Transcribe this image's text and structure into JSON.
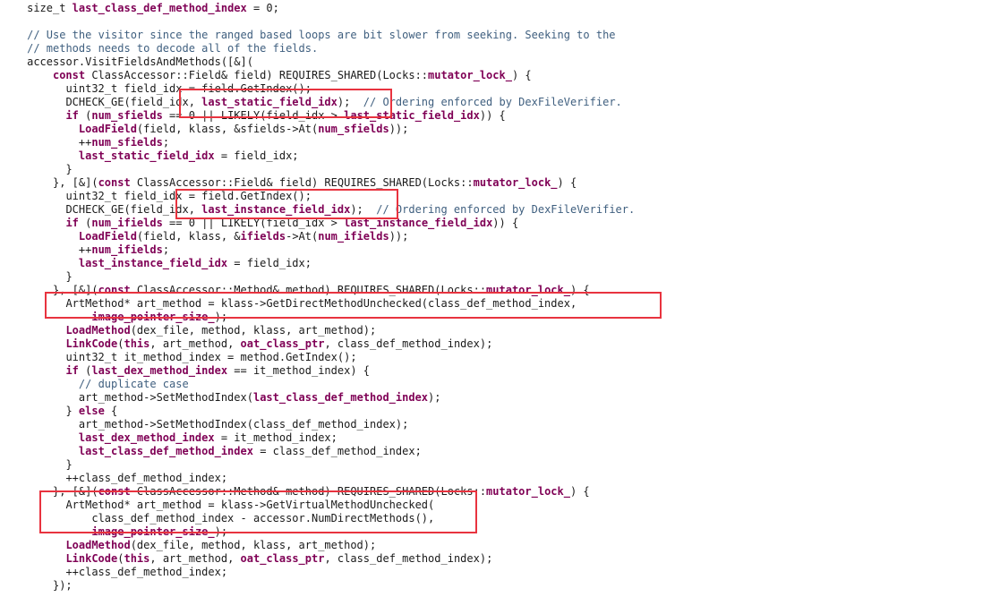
{
  "editor": {
    "language": "C++",
    "token_colors": {
      "keyword": "#7f0055",
      "identifier": "#7f0055",
      "comment": "#3f5f7f",
      "plain": "#1a1a1a",
      "highlight_box": "#e8333f"
    },
    "lines": [
      {
        "indent": "    ",
        "tokens": [
          [
            "plain",
            "size_t "
          ],
          [
            "var",
            "last_class_def_method_index"
          ],
          [
            "plain",
            " = 0;"
          ]
        ]
      },
      {
        "indent": "",
        "tokens": []
      },
      {
        "indent": "    ",
        "tokens": [
          [
            "cmt",
            "// Use the visitor since the ranged based loops are bit slower from seeking. Seeking to the"
          ]
        ]
      },
      {
        "indent": "    ",
        "tokens": [
          [
            "cmt",
            "// methods needs to decode all of the fields."
          ]
        ]
      },
      {
        "indent": "    ",
        "tokens": [
          [
            "plain",
            "accessor.VisitFieldsAndMethods([&]("
          ]
        ]
      },
      {
        "indent": "        ",
        "tokens": [
          [
            "kw",
            "const"
          ],
          [
            "plain",
            " ClassAccessor::Field& field) REQUIRES_SHARED(Locks::"
          ],
          [
            "var",
            "mutator_lock_"
          ],
          [
            "plain",
            ") {"
          ]
        ]
      },
      {
        "indent": "          ",
        "tokens": [
          [
            "plain",
            "uint32_t field_idx = field.GetIndex();"
          ]
        ]
      },
      {
        "indent": "          ",
        "tokens": [
          [
            "plain",
            "DCHECK_GE(field_idx, "
          ],
          [
            "var",
            "last_static_field_idx"
          ],
          [
            "plain",
            ");  "
          ],
          [
            "cmt",
            "// Ordering enforced by DexFileVerifier."
          ]
        ]
      },
      {
        "indent": "          ",
        "tokens": [
          [
            "kw",
            "if"
          ],
          [
            "plain",
            " ("
          ],
          [
            "var",
            "num_sfields"
          ],
          [
            "plain",
            " == 0 || LIKELY(field_idx > "
          ],
          [
            "var",
            "last_static_field_idx"
          ],
          [
            "plain",
            ")) {"
          ]
        ]
      },
      {
        "indent": "            ",
        "tokens": [
          [
            "func",
            "LoadField"
          ],
          [
            "plain",
            "(field, klass, &sfields->At("
          ],
          [
            "var",
            "num_sfields"
          ],
          [
            "plain",
            "));"
          ]
        ]
      },
      {
        "indent": "            ",
        "tokens": [
          [
            "plain",
            "++"
          ],
          [
            "var",
            "num_sfields"
          ],
          [
            "plain",
            ";"
          ]
        ]
      },
      {
        "indent": "            ",
        "tokens": [
          [
            "var",
            "last_static_field_idx"
          ],
          [
            "plain",
            " = field_idx;"
          ]
        ]
      },
      {
        "indent": "          ",
        "tokens": [
          [
            "plain",
            "}"
          ]
        ]
      },
      {
        "indent": "        ",
        "tokens": [
          [
            "plain",
            "}, [&]("
          ],
          [
            "kw",
            "const"
          ],
          [
            "plain",
            " ClassAccessor::Field& field) REQUIRES_SHARED(Locks::"
          ],
          [
            "var",
            "mutator_lock_"
          ],
          [
            "plain",
            ") {"
          ]
        ]
      },
      {
        "indent": "          ",
        "tokens": [
          [
            "plain",
            "uint32_t field_idx = field.GetIndex();"
          ]
        ]
      },
      {
        "indent": "          ",
        "tokens": [
          [
            "plain",
            "DCHECK_GE(field_idx, "
          ],
          [
            "var",
            "last_instance_field_idx"
          ],
          [
            "plain",
            ");  "
          ],
          [
            "cmt",
            "// Ordering enforced by DexFileVerifier."
          ]
        ]
      },
      {
        "indent": "          ",
        "tokens": [
          [
            "kw",
            "if"
          ],
          [
            "plain",
            " ("
          ],
          [
            "var",
            "num_ifields"
          ],
          [
            "plain",
            " == 0 || LIKELY(field_idx > "
          ],
          [
            "var",
            "last_instance_field_idx"
          ],
          [
            "plain",
            ")) {"
          ]
        ]
      },
      {
        "indent": "            ",
        "tokens": [
          [
            "func",
            "LoadField"
          ],
          [
            "plain",
            "(field, klass, &"
          ],
          [
            "var",
            "ifields"
          ],
          [
            "plain",
            "->At("
          ],
          [
            "var",
            "num_ifields"
          ],
          [
            "plain",
            "));"
          ]
        ]
      },
      {
        "indent": "            ",
        "tokens": [
          [
            "plain",
            "++"
          ],
          [
            "var",
            "num_ifields"
          ],
          [
            "plain",
            ";"
          ]
        ]
      },
      {
        "indent": "            ",
        "tokens": [
          [
            "var",
            "last_instance_field_idx"
          ],
          [
            "plain",
            " = field_idx;"
          ]
        ]
      },
      {
        "indent": "          ",
        "tokens": [
          [
            "plain",
            "}"
          ]
        ]
      },
      {
        "indent": "        ",
        "tokens": [
          [
            "plain",
            "}, [&]("
          ],
          [
            "kw",
            "const"
          ],
          [
            "plain",
            " ClassAccessor::Method& method) REQUIRES_SHARED(Locks::"
          ],
          [
            "var",
            "mutator_lock_"
          ],
          [
            "plain",
            ") {"
          ]
        ]
      },
      {
        "indent": "          ",
        "tokens": [
          [
            "plain",
            "ArtMethod* art_method = klass->GetDirectMethodUnchecked(class_def_method_index,"
          ]
        ]
      },
      {
        "indent": "              ",
        "tokens": [
          [
            "var",
            "image_pointer_size_"
          ],
          [
            "plain",
            ");"
          ]
        ]
      },
      {
        "indent": "          ",
        "tokens": [
          [
            "func",
            "LoadMethod"
          ],
          [
            "plain",
            "(dex_file, method, klass, art_method);"
          ]
        ]
      },
      {
        "indent": "          ",
        "tokens": [
          [
            "func",
            "LinkCode"
          ],
          [
            "plain",
            "("
          ],
          [
            "kw",
            "this"
          ],
          [
            "plain",
            ", art_method, "
          ],
          [
            "var",
            "oat_class_ptr"
          ],
          [
            "plain",
            ", class_def_method_index);"
          ]
        ]
      },
      {
        "indent": "          ",
        "tokens": [
          [
            "plain",
            "uint32_t it_method_index = method.GetIndex();"
          ]
        ]
      },
      {
        "indent": "          ",
        "tokens": [
          [
            "kw",
            "if"
          ],
          [
            "plain",
            " ("
          ],
          [
            "var",
            "last_dex_method_index"
          ],
          [
            "plain",
            " == it_method_index) {"
          ]
        ]
      },
      {
        "indent": "            ",
        "tokens": [
          [
            "cmt",
            "// duplicate case"
          ]
        ]
      },
      {
        "indent": "            ",
        "tokens": [
          [
            "plain",
            "art_method->SetMethodIndex("
          ],
          [
            "var",
            "last_class_def_method_index"
          ],
          [
            "plain",
            ");"
          ]
        ]
      },
      {
        "indent": "          ",
        "tokens": [
          [
            "plain",
            "} "
          ],
          [
            "kw",
            "else"
          ],
          [
            "plain",
            " {"
          ]
        ]
      },
      {
        "indent": "            ",
        "tokens": [
          [
            "plain",
            "art_method->SetMethodIndex(class_def_method_index);"
          ]
        ]
      },
      {
        "indent": "            ",
        "tokens": [
          [
            "var",
            "last_dex_method_index"
          ],
          [
            "plain",
            " = it_method_index;"
          ]
        ]
      },
      {
        "indent": "            ",
        "tokens": [
          [
            "var",
            "last_class_def_method_index"
          ],
          [
            "plain",
            " = class_def_method_index;"
          ]
        ]
      },
      {
        "indent": "          ",
        "tokens": [
          [
            "plain",
            "}"
          ]
        ]
      },
      {
        "indent": "          ",
        "tokens": [
          [
            "plain",
            "++class_def_method_index;"
          ]
        ]
      },
      {
        "indent": "        ",
        "tokens": [
          [
            "plain",
            "}, [&]("
          ],
          [
            "kw",
            "const"
          ],
          [
            "plain",
            " ClassAccessor::Method& method) REQUIRES_SHARED(Locks::"
          ],
          [
            "var",
            "mutator_lock_"
          ],
          [
            "plain",
            ") {"
          ]
        ]
      },
      {
        "indent": "          ",
        "tokens": [
          [
            "plain",
            "ArtMethod* art_method = klass->GetVirtualMethodUnchecked("
          ]
        ]
      },
      {
        "indent": "              ",
        "tokens": [
          [
            "plain",
            "class_def_method_index - accessor.NumDirectMethods(),"
          ]
        ]
      },
      {
        "indent": "              ",
        "tokens": [
          [
            "var",
            "image_pointer_size_"
          ],
          [
            "plain",
            ");"
          ]
        ]
      },
      {
        "indent": "          ",
        "tokens": [
          [
            "func",
            "LoadMethod"
          ],
          [
            "plain",
            "(dex_file, method, klass, art_method);"
          ]
        ]
      },
      {
        "indent": "          ",
        "tokens": [
          [
            "func",
            "LinkCode"
          ],
          [
            "plain",
            "("
          ],
          [
            "kw",
            "this"
          ],
          [
            "plain",
            ", art_method, "
          ],
          [
            "var",
            "oat_class_ptr"
          ],
          [
            "plain",
            ", class_def_method_index);"
          ]
        ]
      },
      {
        "indent": "          ",
        "tokens": [
          [
            "plain",
            "++class_def_method_index;"
          ]
        ]
      },
      {
        "indent": "        ",
        "tokens": [
          [
            "plain",
            "});"
          ]
        ]
      }
    ],
    "highlights": [
      {
        "name": "highlight-last-static-field-idx",
        "label": "last_static_field_idx"
      },
      {
        "name": "highlight-last-instance-field-idx",
        "label": "last_instance_field_idx"
      },
      {
        "name": "highlight-get-direct-method",
        "label": "GetDirectMethodUnchecked"
      },
      {
        "name": "highlight-get-virtual-method",
        "label": "GetVirtualMethodUnchecked"
      }
    ]
  }
}
